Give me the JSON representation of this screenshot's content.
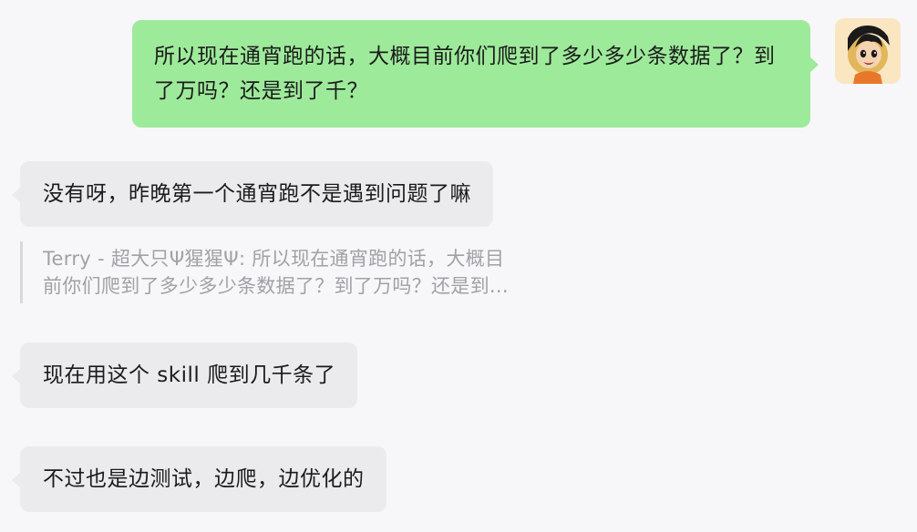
{
  "outgoing_message": {
    "text": "所以现在通宵跑的话，大概目前你们爬到了多少多少条数据了？到了万吗？还是到了千？"
  },
  "incoming_messages": [
    {
      "text": "没有呀，昨晚第一个通宵跑不是遇到问题了嘛"
    },
    {
      "text": "现在用这个 skill 爬到几千条了"
    },
    {
      "text": "不过也是边测试，边爬，边优化的"
    }
  ],
  "quote": {
    "line1": "Terry - 超大只Ψ猩猩Ψ: 所以现在通宵跑的话，大概目",
    "line2": "前你们爬到了多少多少条数据了？到了万吗？还是到..."
  },
  "colors": {
    "background": "#f7f7f9",
    "outgoing_bubble": "#9eea9b",
    "incoming_bubble": "#ebebee",
    "quote_text": "#a1a1a6"
  },
  "avatar_icon": "anime-character-avatar"
}
